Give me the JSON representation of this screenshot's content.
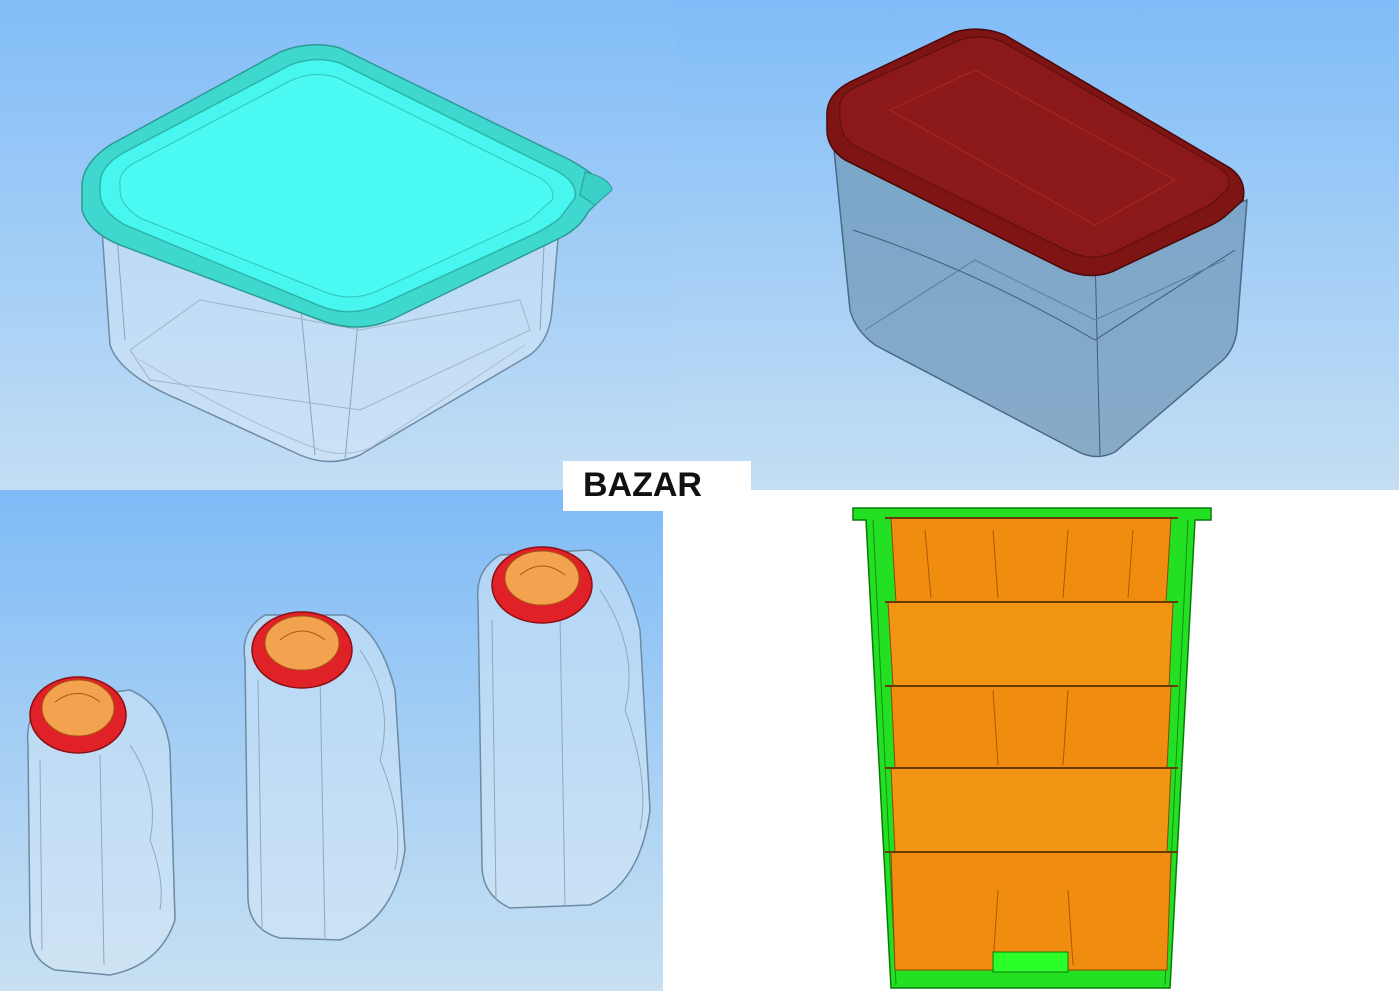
{
  "label": {
    "text": "BAZAR"
  },
  "colors": {
    "lid_cyan": "#44f5ef",
    "lid_red": "#8a1717",
    "cap_red": "#e8222b",
    "cap_orange": "#f5a857",
    "cup_green": "#22e022",
    "cup_orange": "#f08c10",
    "background_blue": "#8fc5f8"
  },
  "panels": [
    {
      "name": "square-container",
      "icon": "square-food-container-cyan-lid"
    },
    {
      "name": "rectangular-container",
      "icon": "rectangular-food-container-red-lid"
    },
    {
      "name": "bottles",
      "icon": "three-handled-bottles-red-caps"
    },
    {
      "name": "stacked-cups",
      "icon": "stacked-orange-cups-in-green-cup"
    }
  ]
}
